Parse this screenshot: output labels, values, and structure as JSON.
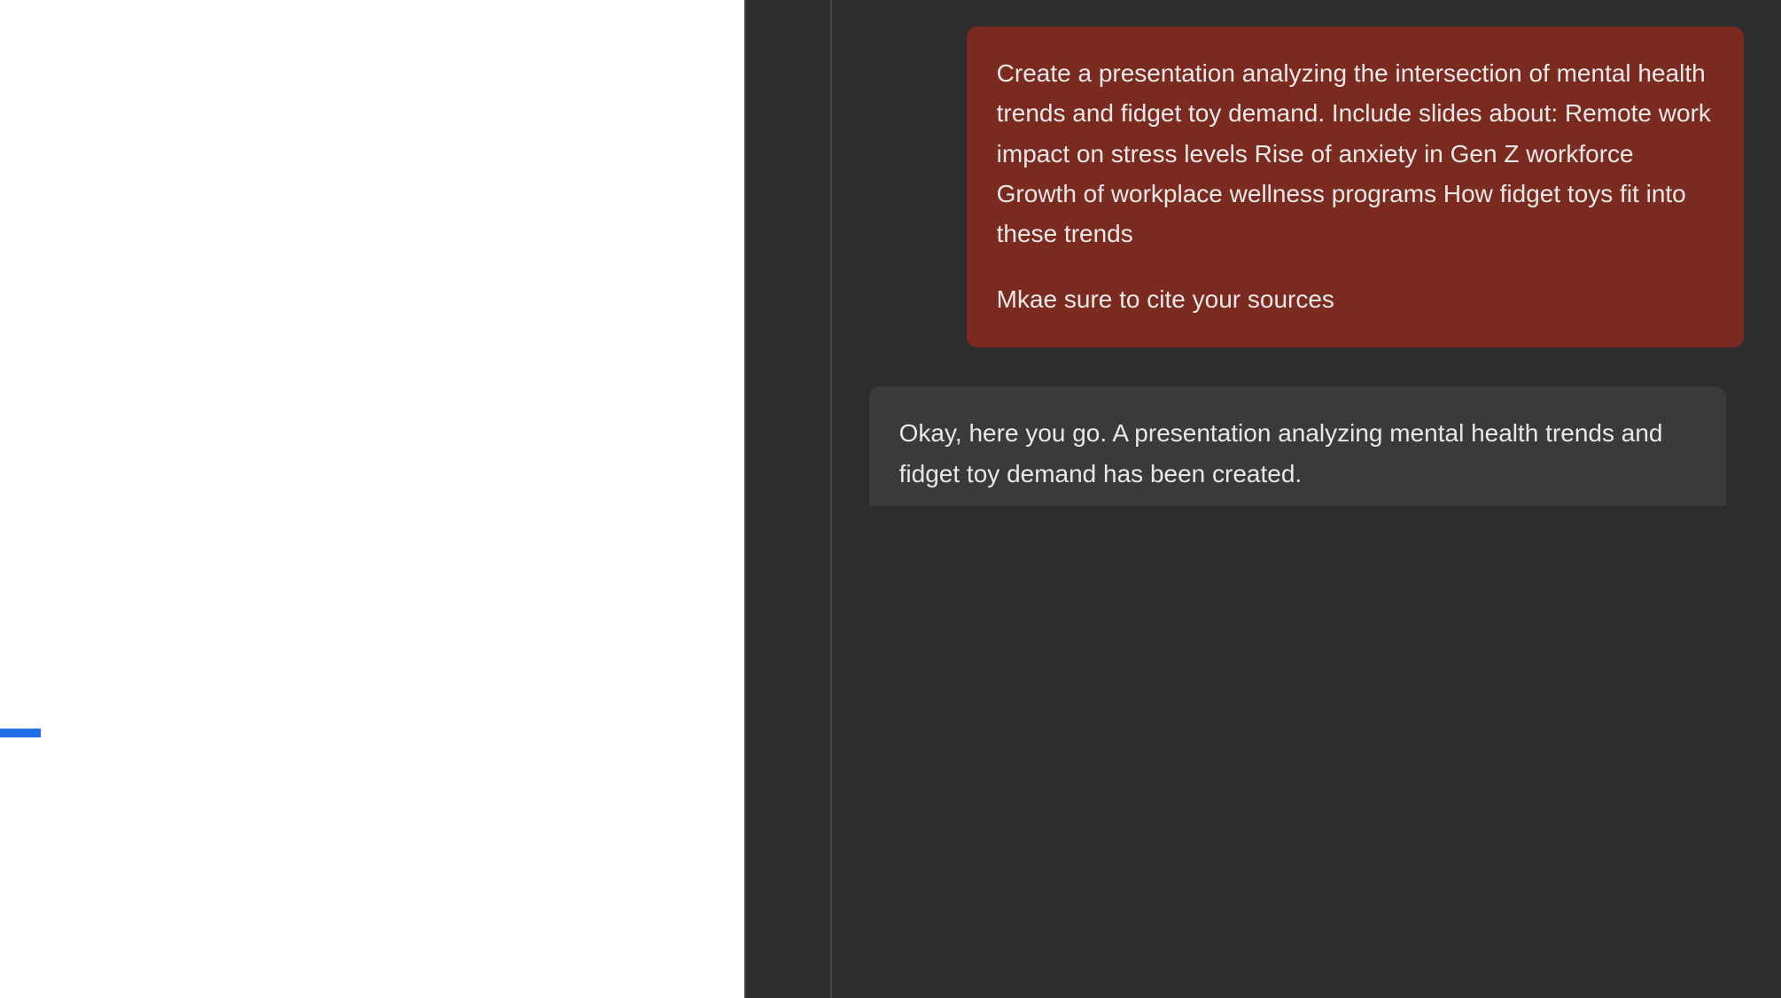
{
  "chat": {
    "messages": [
      {
        "role": "user",
        "paragraphs": [
          "Create a presentation analyzing the intersection of mental health trends and fidget toy demand. Include slides about: Remote work impact on stress levels Rise of anxiety in Gen Z workforce Growth of workplace wellness programs How fidget toys fit into these trends",
          "Mkae sure to cite your sources"
        ]
      },
      {
        "role": "assistant",
        "paragraphs": [
          "Okay, here you go. A presentation analyzing mental health trends and fidget toy demand has been created."
        ]
      }
    ]
  },
  "colors": {
    "user_bubble": "#7A2A1E",
    "assistant_bubble": "#3a3a3a",
    "chat_bg": "#2d2d2d",
    "accent_blue": "#1F6FEB"
  }
}
